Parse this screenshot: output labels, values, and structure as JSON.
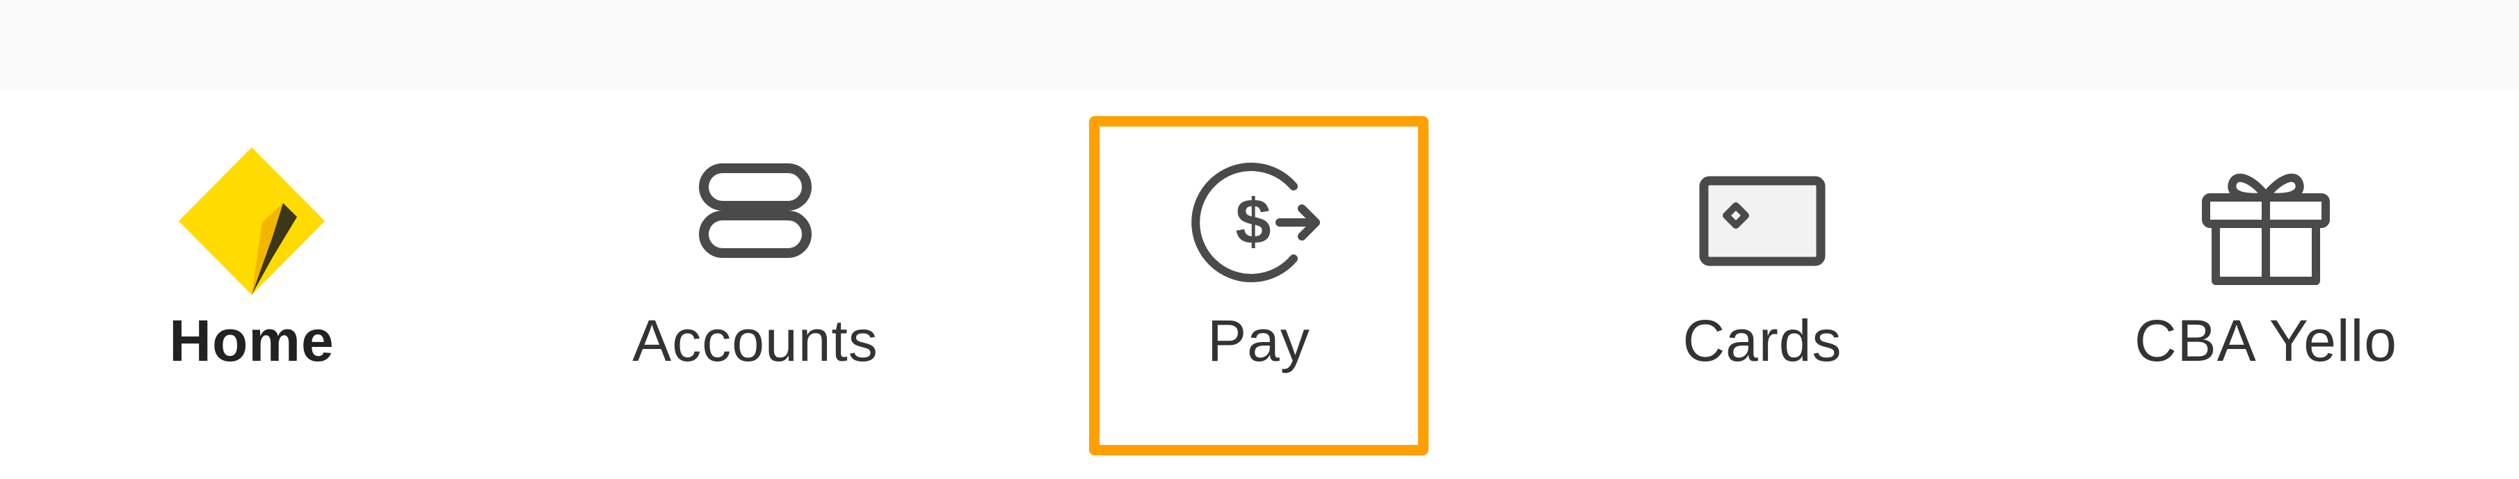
{
  "nav": {
    "items": [
      {
        "label": "Home",
        "icon": "cba-logo-icon",
        "active": true
      },
      {
        "label": "Accounts",
        "icon": "accounts-icon",
        "active": false
      },
      {
        "label": "Pay",
        "icon": "pay-icon",
        "active": false
      },
      {
        "label": "Cards",
        "icon": "card-icon",
        "active": false
      },
      {
        "label": "CBA Yello",
        "icon": "gift-icon",
        "active": false
      }
    ]
  },
  "colors": {
    "highlight": "#ff9f00",
    "logo_yellow": "#ffcc00",
    "icon_stroke": "#4a4a4a",
    "text": "#333333"
  }
}
